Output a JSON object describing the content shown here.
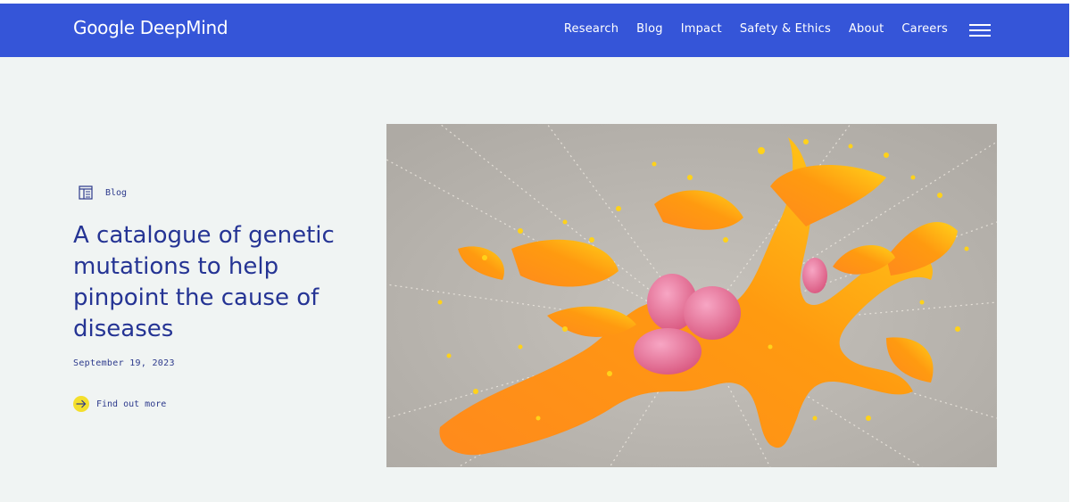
{
  "brand": {
    "name": "Google DeepMind"
  },
  "nav": {
    "items": [
      {
        "label": "Research"
      },
      {
        "label": "Blog"
      },
      {
        "label": "Impact"
      },
      {
        "label": "Safety & Ethics"
      },
      {
        "label": "About"
      },
      {
        "label": "Careers"
      }
    ],
    "menu_icon": "hamburger-menu-icon"
  },
  "article": {
    "category": "Blog",
    "category_icon": "article-icon",
    "title": "A catalogue of genetic mutations to help pinpoint the cause of diseases",
    "date": "September 19, 2023",
    "cta_label": "Find out more",
    "cta_icon": "arrow-right-icon"
  },
  "colors": {
    "header": "#3555d8",
    "background": "#f0f4f3",
    "text": "#253494",
    "accent": "#f4df2c"
  }
}
